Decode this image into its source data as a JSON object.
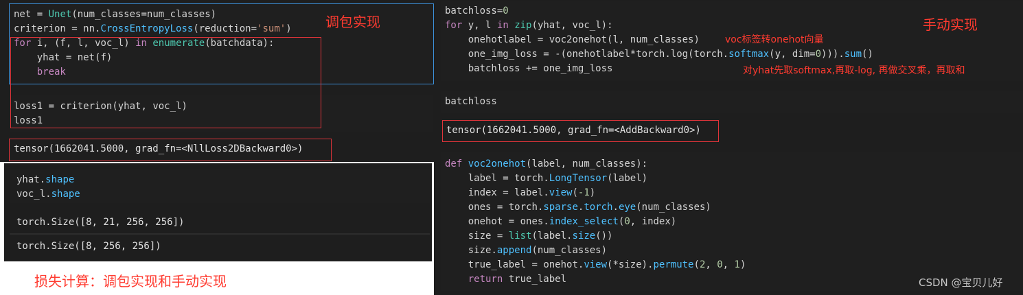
{
  "left_top": {
    "cell1": [
      "net = Unet(num_classes=num_classes)",
      "criterion = nn.CrossEntropyLoss(reduction='sum')",
      "for i, (f, l, voc_l) in enumerate(batchdata):",
      "    yhat = net(f)",
      "    break"
    ],
    "cell2": [
      "loss1 = criterion(yhat, voc_l)",
      "loss1"
    ],
    "output": "tensor(1662041.5000, grad_fn=<NllLoss2DBackward0>)",
    "annotation": "调包实现"
  },
  "left_bottom": {
    "cell": [
      "yhat.shape",
      "voc_l.shape"
    ],
    "output1": "torch.Size([8, 21, 256, 256])",
    "output2": "torch.Size([8, 256, 256])",
    "caption": "损失计算：调包实现和手动实现"
  },
  "right": {
    "cell1": [
      "batchloss=0",
      "for y, l in zip(yhat, voc_l):",
      "    onehotlabel = voc2onehot(l, num_classes)",
      "    one_img_loss = -(onehotlabel*torch.log(torch.softmax(y, dim=0))).sum()",
      "    batchloss += one_img_loss"
    ],
    "annotation_title": "手动实现",
    "annotation_onehot": "voc标签转onehot向量",
    "annotation_softmax": "对yhat先取softmax,再取-log, 再做交叉乘，再取和",
    "cell2": [
      "batchloss"
    ],
    "output": "tensor(1662041.5000, grad_fn=<AddBackward0>)",
    "cell3": [
      "def voc2onehot(label, num_classes):",
      "    label = torch.LongTensor(label)",
      "    index = label.view(-1)",
      "    ones = torch.sparse.torch.eye(num_classes)",
      "    onehot = ones.index_select(0, index)",
      "    size = list(label.size())",
      "    size.append(num_classes)",
      "    true_label = onehot.view(*size).permute(2, 0, 1)",
      "    return true_label"
    ],
    "watermark": "CSDN @宝贝儿好"
  }
}
